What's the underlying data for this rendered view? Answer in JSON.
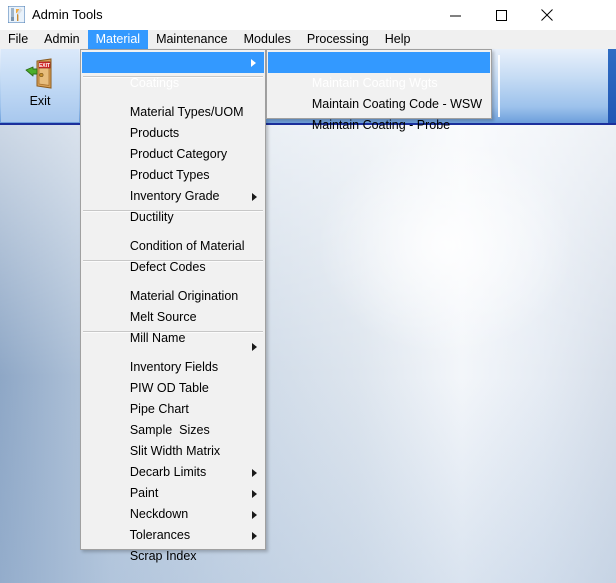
{
  "window": {
    "title": "Admin Tools",
    "icon": "tools-icon",
    "controls": {
      "minimize": "minimize-icon",
      "maximize": "maximize-icon",
      "close": "close-icon"
    }
  },
  "menu_bar": {
    "items": [
      {
        "label": "File",
        "active": false
      },
      {
        "label": "Admin",
        "active": false
      },
      {
        "label": "Material",
        "active": true
      },
      {
        "label": "Maintenance",
        "active": false
      },
      {
        "label": "Modules",
        "active": false
      },
      {
        "label": "Processing",
        "active": false
      },
      {
        "label": "Help",
        "active": false
      }
    ]
  },
  "toolbar": {
    "exit_label": "Exit",
    "exit_icon": "exit-door-icon",
    "exit_sign_text": "EXIT"
  },
  "material_menu": {
    "groups": [
      {
        "items": [
          {
            "label": "Coatings",
            "submenu": true,
            "highlight": true
          }
        ]
      },
      {
        "items": [
          {
            "label": "Material Types/UOM",
            "submenu": false,
            "highlight": false
          },
          {
            "label": "Products",
            "submenu": false,
            "highlight": false
          },
          {
            "label": "Product Category",
            "submenu": false,
            "highlight": false
          },
          {
            "label": "Product Types",
            "submenu": false,
            "highlight": false
          },
          {
            "label": "Inventory Grade",
            "submenu": false,
            "highlight": false
          },
          {
            "label": "Ductility",
            "submenu": true,
            "highlight": false
          }
        ]
      },
      {
        "items": [
          {
            "label": "Condition of Material",
            "submenu": false,
            "highlight": false
          },
          {
            "label": "Defect Codes",
            "submenu": false,
            "highlight": false
          }
        ]
      },
      {
        "items": [
          {
            "label": "Material Origination",
            "submenu": false,
            "highlight": false
          },
          {
            "label": "Melt Source",
            "submenu": false,
            "highlight": false
          },
          {
            "label": "Mill Name",
            "submenu": false,
            "highlight": false
          }
        ]
      },
      {
        "items": [
          {
            "label": "Inventory Fields",
            "submenu": true,
            "highlight": false
          },
          {
            "label": "PIW OD Table",
            "submenu": false,
            "highlight": false
          },
          {
            "label": "Pipe Chart",
            "submenu": false,
            "highlight": false
          },
          {
            "label": "Sample  Sizes",
            "submenu": false,
            "highlight": false
          },
          {
            "label": "Slit Width Matrix",
            "submenu": false,
            "highlight": false
          },
          {
            "label": "Decarb Limits",
            "submenu": false,
            "highlight": false
          },
          {
            "label": "Paint",
            "submenu": true,
            "highlight": false
          },
          {
            "label": "Neckdown",
            "submenu": true,
            "highlight": false
          },
          {
            "label": "Tolerances",
            "submenu": true,
            "highlight": false
          },
          {
            "label": "Scrap Index",
            "submenu": true,
            "highlight": false
          }
        ]
      }
    ]
  },
  "coatings_submenu": {
    "items": [
      {
        "label": "Maintain Coating Wgts",
        "highlight": true
      },
      {
        "label": "Maintain Coating Code - WSW",
        "highlight": false
      },
      {
        "label": "Maintain Coating - Probe",
        "highlight": false
      }
    ]
  },
  "colors": {
    "highlight_blue": "#3399ff",
    "menu_background": "#f1f1f1",
    "toolbar_accent": "#1b2f9c"
  }
}
